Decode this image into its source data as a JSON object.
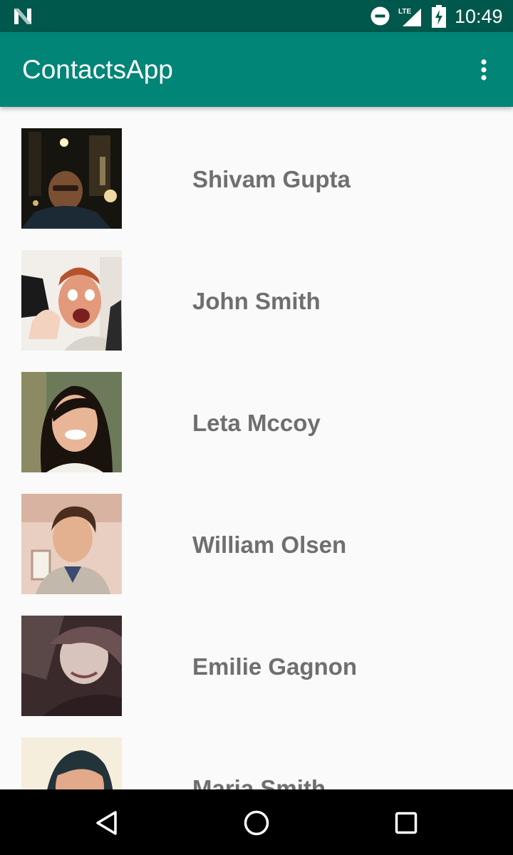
{
  "status_bar": {
    "time": "10:49",
    "icons": [
      "n-icon",
      "do-not-disturb-icon",
      "lte-signal-icon",
      "battery-charging-icon"
    ]
  },
  "app_bar": {
    "title": "ContactsApp",
    "overflow_icon": "more-vert-icon"
  },
  "contacts": [
    {
      "name": "Shivam Gupta"
    },
    {
      "name": "John Smith"
    },
    {
      "name": "Leta Mccoy"
    },
    {
      "name": "William Olsen"
    },
    {
      "name": "Emilie Gagnon"
    },
    {
      "name": "Maria Smith"
    }
  ],
  "nav_bar": {
    "icons": [
      "back-icon",
      "home-icon",
      "recents-icon"
    ]
  }
}
